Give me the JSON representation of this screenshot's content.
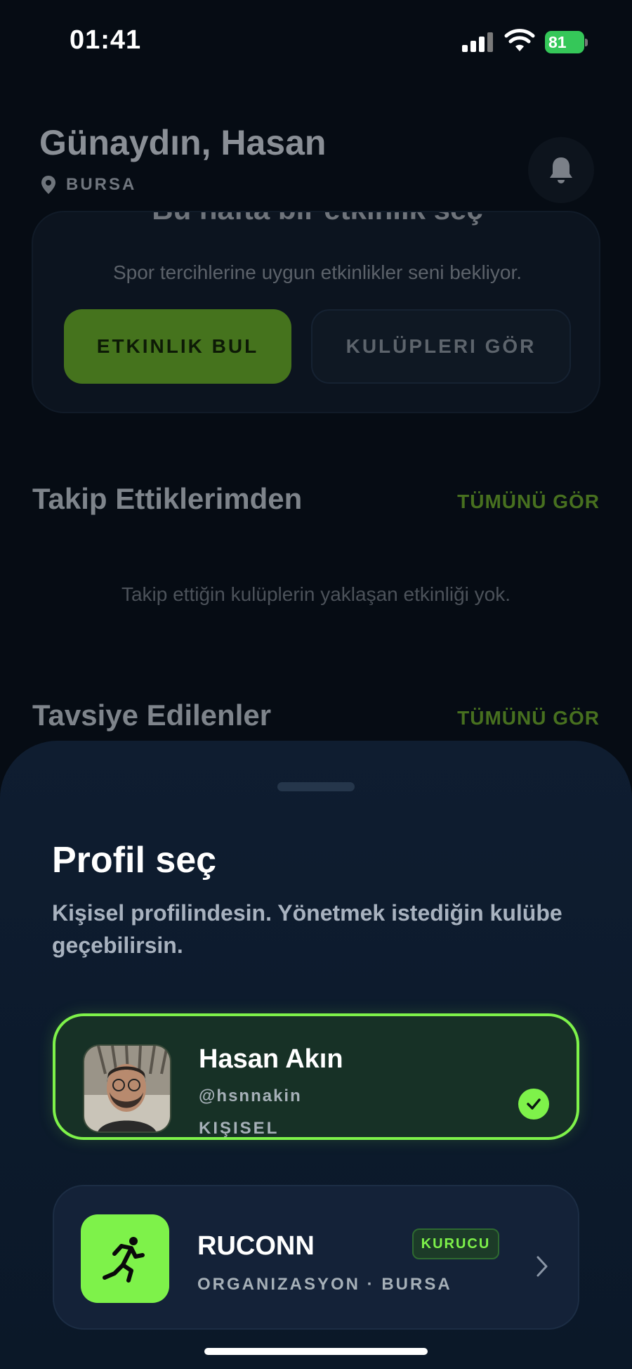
{
  "status_bar": {
    "time": "01:41",
    "battery": "81"
  },
  "home": {
    "greeting": "Günaydın, Hasan",
    "location": "BURSA",
    "challenge": {
      "title": "Bu hafta bir etkinlik seç",
      "subtitle": "Spor tercihlerine uygun etkinlikler seni bekliyor.",
      "find_button": "ETKINLIK BUL",
      "clubs_button": "KULÜPLERI GÖR"
    },
    "following": {
      "title": "Takip Ettiklerimden",
      "see_all": "TÜMÜNÜ GÖR",
      "empty": "Takip ettiğin kulüplerin yaklaşan etkinliği yok."
    },
    "recommended": {
      "title": "Tavsiye Edilenler",
      "see_all": "TÜMÜNÜ GÖR"
    }
  },
  "sheet": {
    "title": "Profil seç",
    "description": "Kişisel profilindesin. Yönetmek istediğin kulübe geçebilirsin.",
    "profiles": [
      {
        "name": "Hasan Akın",
        "handle": "@hsnnakin",
        "type": "KIŞISEL",
        "selected": true
      },
      {
        "name": "RUCONN",
        "subtitle": "ORGANIZASYON · BURSA",
        "badge": "KURUCU",
        "selected": false
      }
    ]
  },
  "colors": {
    "accent": "#7ef24a",
    "background": "#060c14",
    "sheet": "#0f1d30"
  },
  "icons": [
    "signal-icon",
    "wifi-icon",
    "battery-icon",
    "location-pin-icon",
    "bell-icon",
    "check-icon",
    "runner-icon",
    "chevron-right-icon"
  ]
}
